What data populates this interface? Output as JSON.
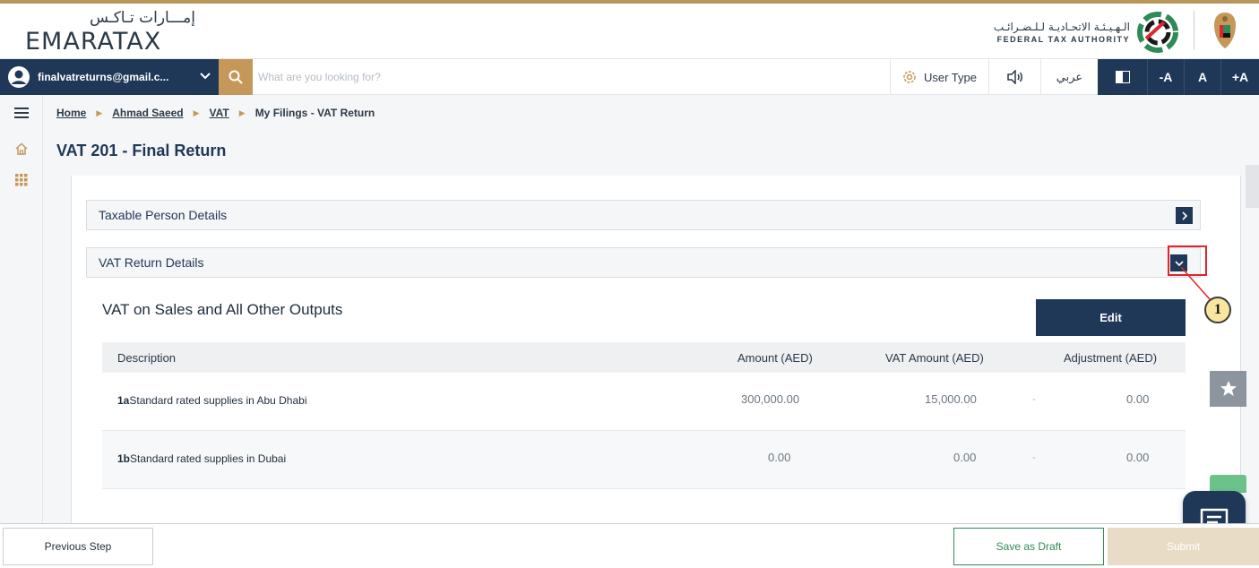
{
  "header": {
    "logo_ar": "إمـــارات تـاكـس",
    "logo_en": "EMARATAX",
    "fta_ar": "الـهـيـئـة الاتحـاديـة لـلـضـرائـب",
    "fta_en": "FEDERAL TAX AUTHORITY"
  },
  "topbar": {
    "user_email": "finalvatreturns@gmail.c...",
    "search_placeholder": "What are you looking for?",
    "user_type_label": "User Type",
    "language_label": "عربي",
    "font_decrease": "-A",
    "font_reset": "A",
    "font_increase": "+A"
  },
  "breadcrumb": {
    "items": [
      "Home",
      "Ahmad Saeed",
      "VAT"
    ],
    "current": "My Filings - VAT Return"
  },
  "page": {
    "title": "VAT 201 - Final Return"
  },
  "accordions": {
    "taxable_person": "Taxable Person Details",
    "vat_return": "VAT Return Details"
  },
  "annotation": {
    "step_number": "1"
  },
  "section": {
    "heading": "VAT on Sales and All Other Outputs",
    "edit_label": "Edit"
  },
  "table": {
    "headers": [
      "Description",
      "Amount (AED)",
      "VAT Amount (AED)",
      "Adjustment (AED)"
    ],
    "rows": [
      {
        "code": "1a",
        "desc": "Standard rated supplies in Abu Dhabi",
        "amount": "300,000.00",
        "vat": "15,000.00",
        "sep": "-",
        "adjustment": "0.00"
      },
      {
        "code": "1b",
        "desc": "Standard rated supplies in Dubai",
        "amount": "0.00",
        "vat": "0.00",
        "sep": "-",
        "adjustment": "0.00"
      }
    ]
  },
  "footer": {
    "previous": "Previous Step",
    "draft": "Save as Draft",
    "submit": "Submit"
  },
  "colors": {
    "navy": "#1f3857",
    "gold": "#c5985a",
    "green": "#2e8b57",
    "highlight_red": "#e0242b"
  }
}
